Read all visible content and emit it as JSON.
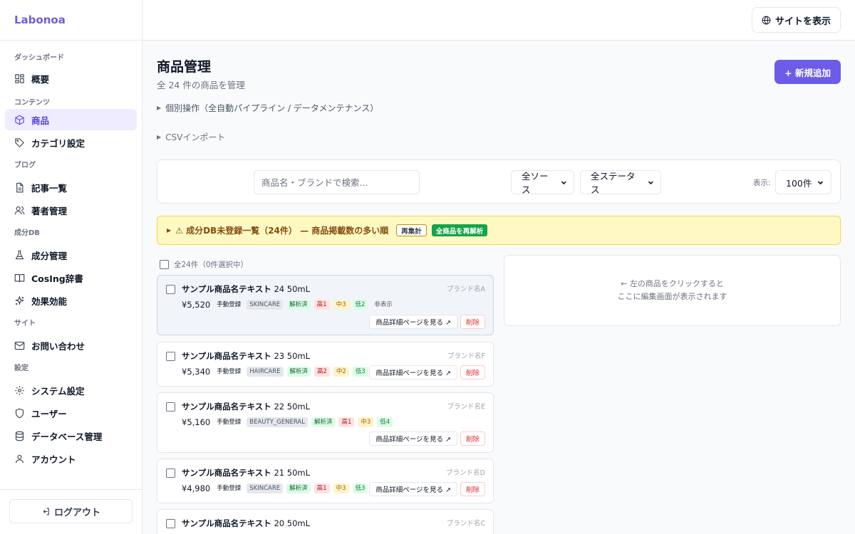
{
  "app": {
    "brand": "Labonoa"
  },
  "sidebar": {
    "sections": {
      "dashboard": "ダッシュボード",
      "content": "コンテンツ",
      "blog": "ブログ",
      "ingredient_db": "成分DB",
      "site": "サイト",
      "settings": "設定"
    },
    "items": {
      "overview": "概要",
      "products": "商品",
      "categories": "カテゴリ設定",
      "articles": "記事一覧",
      "authors": "著者管理",
      "ingredients": "成分管理",
      "cosing": "CosIng辞書",
      "effects": "効果効能",
      "contact": "お問い合わせ",
      "system": "システム設定",
      "users": "ユーザー",
      "database": "データベース管理",
      "account": "アカウント"
    },
    "logout": "ログアウト"
  },
  "topbar": {
    "view_site": "サイトを表示"
  },
  "page": {
    "title": "商品管理",
    "subtitle": "全 24 件の商品を管理",
    "add_button": "+ 新規追加",
    "collapse_ops": "個別操作（全自動パイプライン / データメンテナンス）",
    "collapse_csv": "CSVインポート"
  },
  "filters": {
    "search_placeholder": "商品名・ブランドで検索...",
    "source": "全ソース",
    "status": "全ステータス",
    "show_label": "表示:",
    "per_page": "100件"
  },
  "warning": {
    "text": "⚠ 成分DB未登録一覧（24件） — 商品掲載数の多い順",
    "recount": "再集計",
    "reanalyze": "全商品を再解析"
  },
  "list": {
    "select_all": "全24件（0件選択中）",
    "detail_button": "商品詳細ページを見る ↗",
    "delete_button": "削除",
    "products": [
      {
        "name": "サンプル商品名テキスト",
        "spec": "24 50mL",
        "brand": "ブランド名A",
        "price": "¥5,520",
        "method": "手動登録",
        "source": "SKINCARE",
        "status": "解析済",
        "high": "高1",
        "mid": "中3",
        "low": "低2",
        "visibility": "非表示"
      },
      {
        "name": "サンプル商品名テキスト",
        "spec": "23 50mL",
        "brand": "ブランド名F",
        "price": "¥5,340",
        "method": "手動登録",
        "source": "HAIRCARE",
        "status": "解析済",
        "high": "高2",
        "mid": "中2",
        "low": "低3"
      },
      {
        "name": "サンプル商品名テキスト",
        "spec": "22 50mL",
        "brand": "ブランド名E",
        "price": "¥5,160",
        "method": "手動登録",
        "source": "BEAUTY_GENERAL",
        "status": "解析済",
        "high": "高1",
        "mid": "中3",
        "low": "低4"
      },
      {
        "name": "サンプル商品名テキスト",
        "spec": "21 50mL",
        "brand": "ブランド名D",
        "price": "¥4,980",
        "method": "手動登録",
        "source": "SKINCARE",
        "status": "解析済",
        "high": "高1",
        "mid": "中3",
        "low": "低3"
      },
      {
        "name": "サンプル商品名テキスト",
        "spec": "20 50mL",
        "brand": "ブランド名C"
      }
    ]
  },
  "detail_panel": {
    "line1": "← 左の商品をクリックすると",
    "line2": "ここに編集画面が表示されます"
  }
}
